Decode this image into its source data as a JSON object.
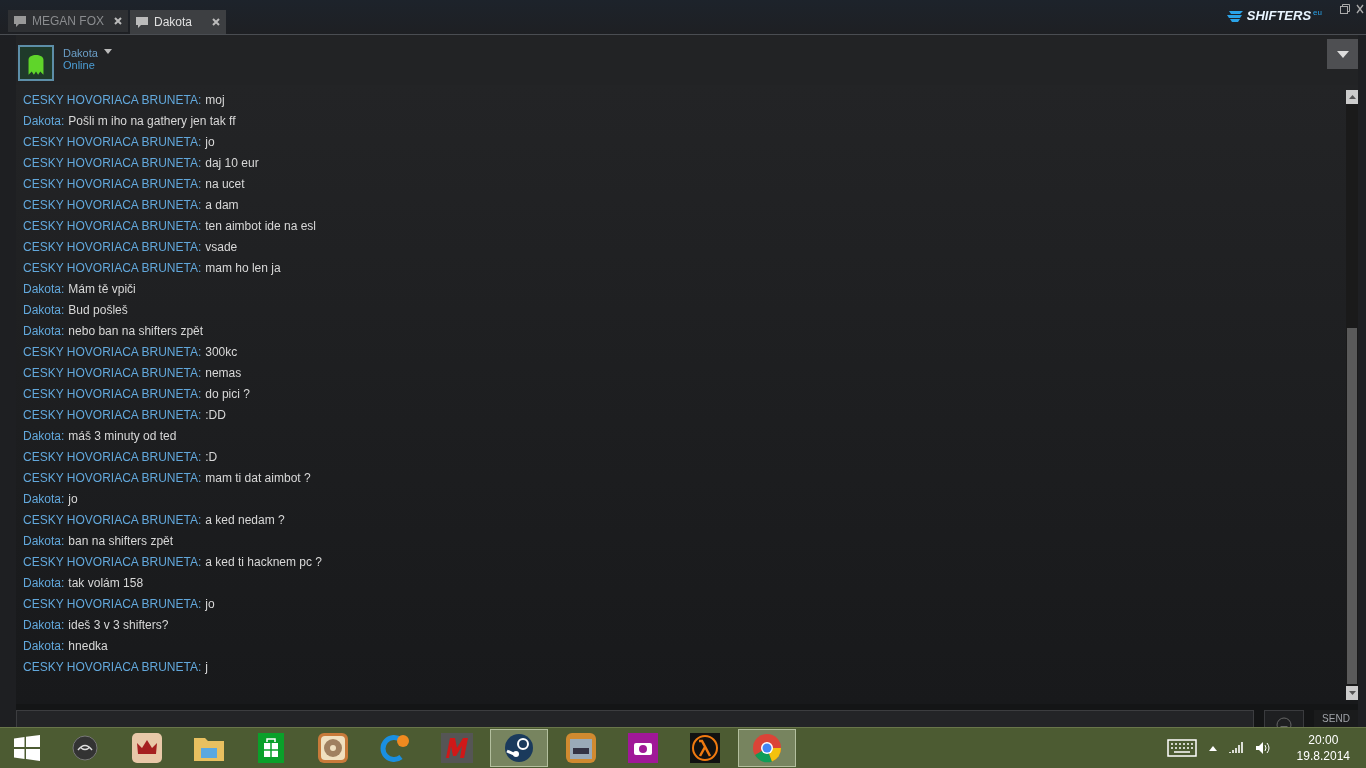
{
  "tabs": [
    {
      "label": "MEGAN FOX",
      "selected": false
    },
    {
      "label": "Dakota",
      "selected": true
    }
  ],
  "logo": {
    "text": "SHIFTERS",
    "suffix": "eu"
  },
  "profile": {
    "name": "Dakota",
    "status": "Online"
  },
  "messages": [
    {
      "sender": "CESKY HOVORIACA BRUNETA:",
      "text": "moj"
    },
    {
      "sender": "Dakota:",
      "text": "Pošli m iho na gathery jen tak ff"
    },
    {
      "sender": "CESKY HOVORIACA BRUNETA:",
      "text": "jo"
    },
    {
      "sender": "CESKY HOVORIACA BRUNETA:",
      "text": "daj 10 eur"
    },
    {
      "sender": "CESKY HOVORIACA BRUNETA:",
      "text": "na ucet"
    },
    {
      "sender": "CESKY HOVORIACA BRUNETA:",
      "text": "a dam"
    },
    {
      "sender": "CESKY HOVORIACA BRUNETA:",
      "text": "ten aimbot ide na esl"
    },
    {
      "sender": "CESKY HOVORIACA BRUNETA:",
      "text": "vsade"
    },
    {
      "sender": "CESKY HOVORIACA BRUNETA:",
      "text": "mam ho len ja"
    },
    {
      "sender": "Dakota:",
      "text": "Mám tě vpiči"
    },
    {
      "sender": "Dakota:",
      "text": "Bud pošleš"
    },
    {
      "sender": "Dakota:",
      "text": "nebo ban na shifters zpět"
    },
    {
      "sender": "CESKY HOVORIACA BRUNETA:",
      "text": "300kc"
    },
    {
      "sender": "CESKY HOVORIACA BRUNETA:",
      "text": "nemas"
    },
    {
      "sender": "CESKY HOVORIACA BRUNETA:",
      "text": "do pici ?"
    },
    {
      "sender": "CESKY HOVORIACA BRUNETA:",
      "text": ":DD"
    },
    {
      "sender": "Dakota:",
      "text": "máš 3 minuty od ted"
    },
    {
      "sender": "CESKY HOVORIACA BRUNETA:",
      "text": ":D"
    },
    {
      "sender": "CESKY HOVORIACA BRUNETA:",
      "text": "mam ti dat aimbot ?"
    },
    {
      "sender": "Dakota:",
      "text": "jo"
    },
    {
      "sender": "CESKY HOVORIACA BRUNETA:",
      "text": "a ked nedam ?"
    },
    {
      "sender": "Dakota:",
      "text": "ban na shifters zpět"
    },
    {
      "sender": "CESKY HOVORIACA BRUNETA:",
      "text": "a ked ti hacknem pc ?"
    },
    {
      "sender": "Dakota:",
      "text": "tak volám 158"
    },
    {
      "sender": "CESKY HOVORIACA BRUNETA:",
      "text": "jo"
    },
    {
      "sender": "Dakota:",
      "text": "ideš 3 v 3 shifters?"
    },
    {
      "sender": "Dakota:",
      "text": "hnedka"
    },
    {
      "sender": "CESKY HOVORIACA BRUNETA:",
      "text": "j"
    }
  ],
  "composer": {
    "send_label": "SEND"
  },
  "taskbar": {
    "apps": [
      {
        "kind": "start",
        "selected": false
      },
      {
        "kind": "round",
        "selected": false
      },
      {
        "kind": "crown",
        "selected": false
      },
      {
        "kind": "folder",
        "selected": false
      },
      {
        "kind": "store",
        "selected": false
      },
      {
        "kind": "disc",
        "selected": false
      },
      {
        "kind": "c",
        "selected": false
      },
      {
        "kind": "m",
        "selected": false
      },
      {
        "kind": "steam",
        "selected": true
      },
      {
        "kind": "doc",
        "selected": false
      },
      {
        "kind": "camera",
        "selected": false
      },
      {
        "kind": "lambda",
        "selected": false
      },
      {
        "kind": "chrome",
        "selected": true
      }
    ],
    "time": "20:00",
    "date": "19.8.2014"
  }
}
